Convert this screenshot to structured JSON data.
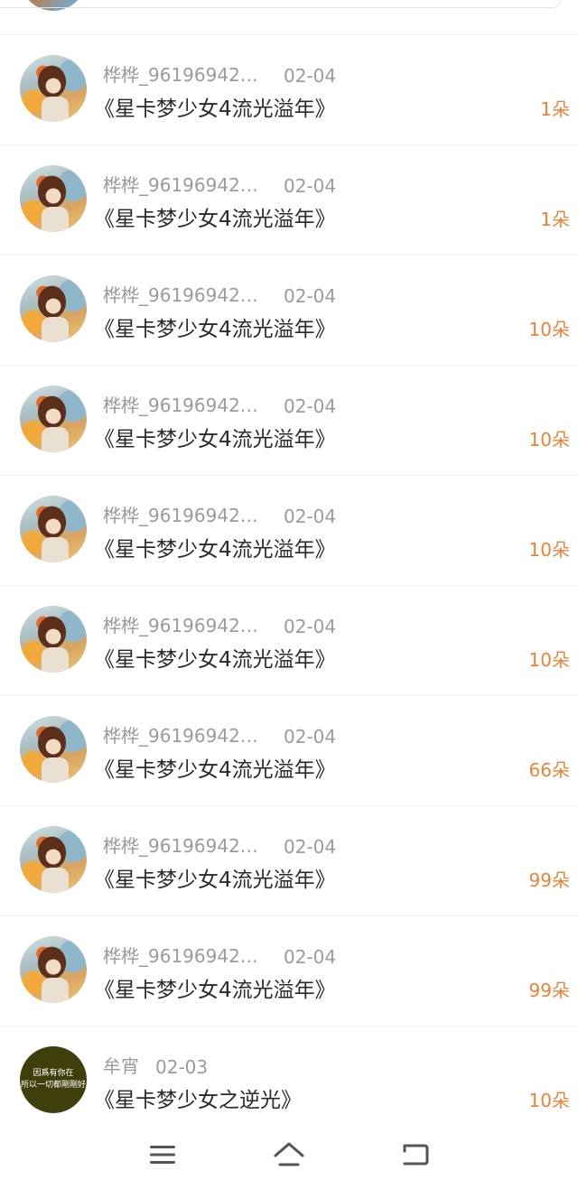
{
  "rows": [
    {
      "user": "桦桦_96196942…",
      "date": "02-04",
      "title": "《星卡梦少女4流光溢年》",
      "amount": "1朵"
    },
    {
      "user": "桦桦_96196942…",
      "date": "02-04",
      "title": "《星卡梦少女4流光溢年》",
      "amount": "1朵"
    },
    {
      "user": "桦桦_96196942…",
      "date": "02-04",
      "title": "《星卡梦少女4流光溢年》",
      "amount": "10朵"
    },
    {
      "user": "桦桦_96196942…",
      "date": "02-04",
      "title": "《星卡梦少女4流光溢年》",
      "amount": "10朵"
    },
    {
      "user": "桦桦_96196942…",
      "date": "02-04",
      "title": "《星卡梦少女4流光溢年》",
      "amount": "10朵"
    },
    {
      "user": "桦桦_96196942…",
      "date": "02-04",
      "title": "《星卡梦少女4流光溢年》",
      "amount": "10朵"
    },
    {
      "user": "桦桦_96196942…",
      "date": "02-04",
      "title": "《星卡梦少女4流光溢年》",
      "amount": "66朵"
    },
    {
      "user": "桦桦_96196942…",
      "date": "02-04",
      "title": "《星卡梦少女4流光溢年》",
      "amount": "99朵"
    },
    {
      "user": "桦桦_96196942…",
      "date": "02-04",
      "title": "《星卡梦少女4流光溢年》",
      "amount": "99朵"
    },
    {
      "user": "牟宵",
      "date": "02-03",
      "title": "《星卡梦少女之逆光》",
      "amount": "10朵",
      "avatar_text_line1": "因爲有你在",
      "avatar_text_line2": "所以一切都剛剛好"
    }
  ],
  "navbar": {
    "menu_icon": "menu-icon",
    "home_icon": "home-icon",
    "back_icon": "back-icon"
  },
  "colors": {
    "amount": "#e8833a",
    "meta": "#9b9b9b",
    "title": "#2a2a2a"
  }
}
